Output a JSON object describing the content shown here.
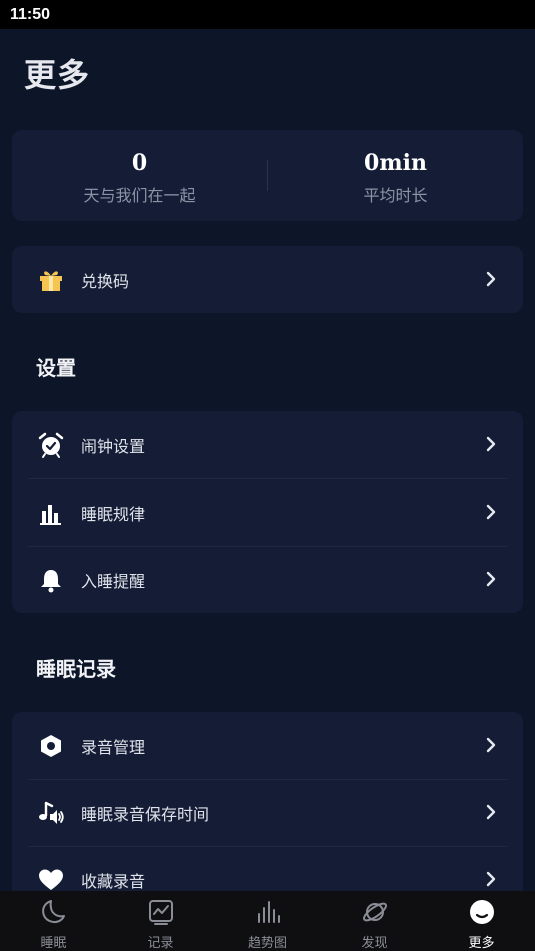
{
  "status_bar": {
    "time": "11:50"
  },
  "page": {
    "title": "更多"
  },
  "stats": [
    {
      "value": "0",
      "label": "天与我们在一起"
    },
    {
      "value": "0min",
      "label": "平均时长"
    }
  ],
  "redeem": {
    "label": "兑换码",
    "icon": "gift-icon"
  },
  "settings": {
    "title": "设置",
    "items": [
      {
        "label": "闹钟设置",
        "icon": "alarm-clock-icon"
      },
      {
        "label": "睡眠规律",
        "icon": "bar-chart-icon"
      },
      {
        "label": "入睡提醒",
        "icon": "bell-icon"
      }
    ]
  },
  "records": {
    "title": "睡眠记录",
    "items": [
      {
        "label": "录音管理",
        "icon": "hexagon-icon"
      },
      {
        "label": "睡眠录音保存时间",
        "icon": "music-speaker-icon"
      },
      {
        "label": "收藏录音",
        "icon": "heart-icon"
      }
    ]
  },
  "tabs": [
    {
      "label": "睡眠",
      "icon": "moon-icon",
      "active": false
    },
    {
      "label": "记录",
      "icon": "chart-frame-icon",
      "active": false
    },
    {
      "label": "趋势图",
      "icon": "equalizer-icon",
      "active": false
    },
    {
      "label": "发现",
      "icon": "planet-icon",
      "active": false
    },
    {
      "label": "更多",
      "icon": "face-icon",
      "active": true
    }
  ],
  "colors": {
    "background": "#0d1529",
    "card": "#141d35",
    "gift_gold": "#f5c451",
    "tab_bar": "#0f0f11"
  }
}
